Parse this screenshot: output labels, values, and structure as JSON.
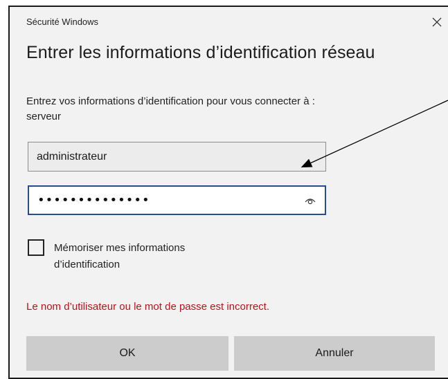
{
  "window": {
    "title": "Sécurité Windows",
    "close_icon": "close-icon"
  },
  "dialog": {
    "heading": "Entrer les informations d’identification réseau",
    "prompt_line1": "Entrez vos informations d’identification pour vous connecter à :",
    "prompt_line2": "serveur"
  },
  "form": {
    "username_value": "administrateur",
    "password_masked": "••••••••••••••",
    "password_length": 14,
    "reveal_icon": "eye-icon",
    "remember_checked": false,
    "remember_label_line1": "Mémoriser mes informations",
    "remember_label_line2": "d’identification"
  },
  "error": {
    "message": "Le nom d’utilisateur ou le mot de passe est incorrect.",
    "color": "#b4141c"
  },
  "buttons": {
    "ok_label": "OK",
    "cancel_label": "Annuler"
  },
  "colors": {
    "dialog_background": "#f2f2f2",
    "focus_border": "#2b4a8a",
    "button_background": "#cccccc"
  }
}
